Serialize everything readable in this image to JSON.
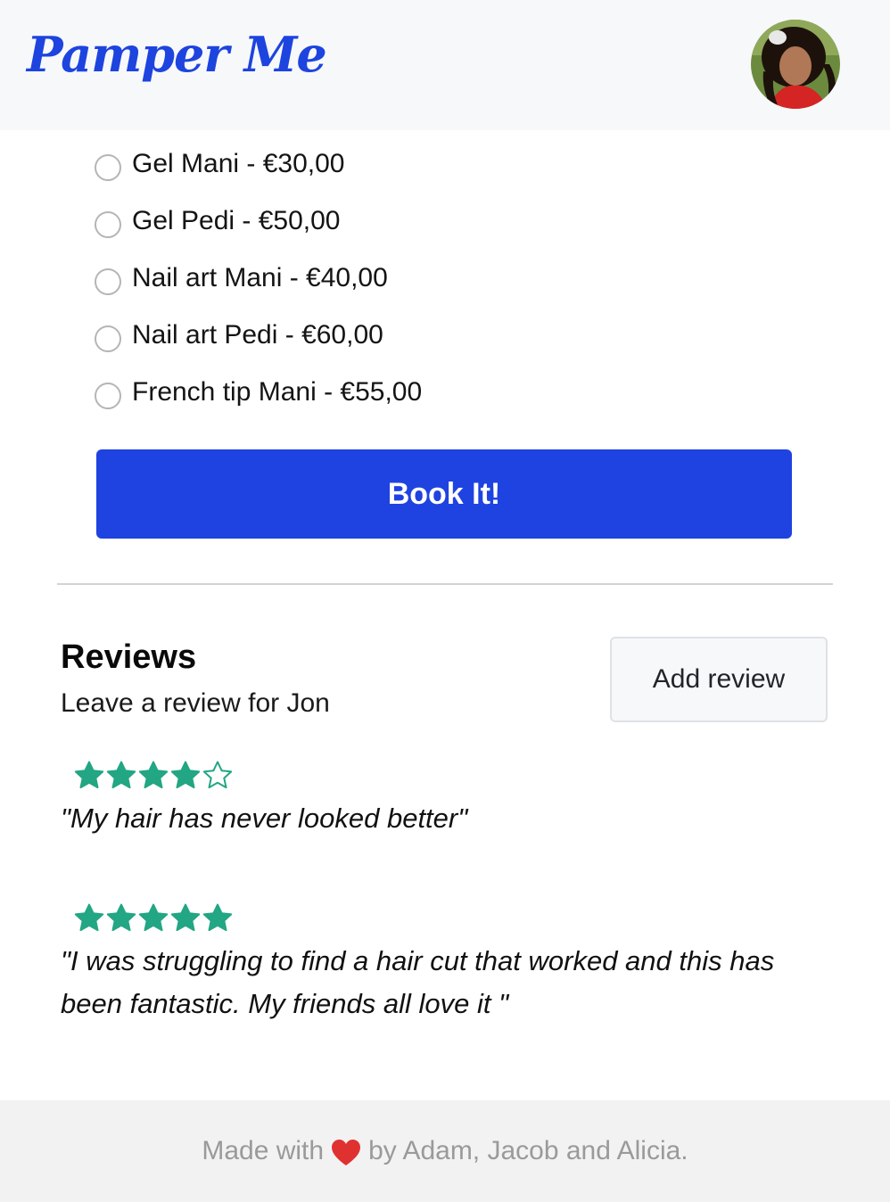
{
  "header": {
    "brand": "Pamper Me",
    "avatar_icon": "user-avatar-icon"
  },
  "services": [
    {
      "label": "Gel Mani - €30,00",
      "selected": false
    },
    {
      "label": "Gel Pedi - €50,00",
      "selected": false
    },
    {
      "label": "Nail art Mani - €40,00",
      "selected": false
    },
    {
      "label": "Nail art Pedi - €60,00",
      "selected": false
    },
    {
      "label": "French tip Mani - €55,00",
      "selected": false
    }
  ],
  "book_button": {
    "label": "Book It!"
  },
  "reviews": {
    "title": "Reviews",
    "subtitle": "Leave a review for Jon",
    "add_button": "Add review",
    "items": [
      {
        "rating": 4,
        "max": 5,
        "text": "\"My hair has never looked better\""
      },
      {
        "rating": 5,
        "max": 5,
        "text": "\"I was struggling to find a hair cut that worked and this has been fantastic. My friends all love it \""
      }
    ]
  },
  "footer": {
    "before": "Made with",
    "after": "by Adam, Jacob and Alicia.",
    "heart_icon": "heart-icon"
  },
  "colors": {
    "brand": "#1d44df",
    "primary_button": "#1f43e0",
    "star": "#22a684",
    "heart": "#e03131",
    "navbar_bg": "#f7f8fa",
    "footer_bg": "#f2f2f2"
  }
}
